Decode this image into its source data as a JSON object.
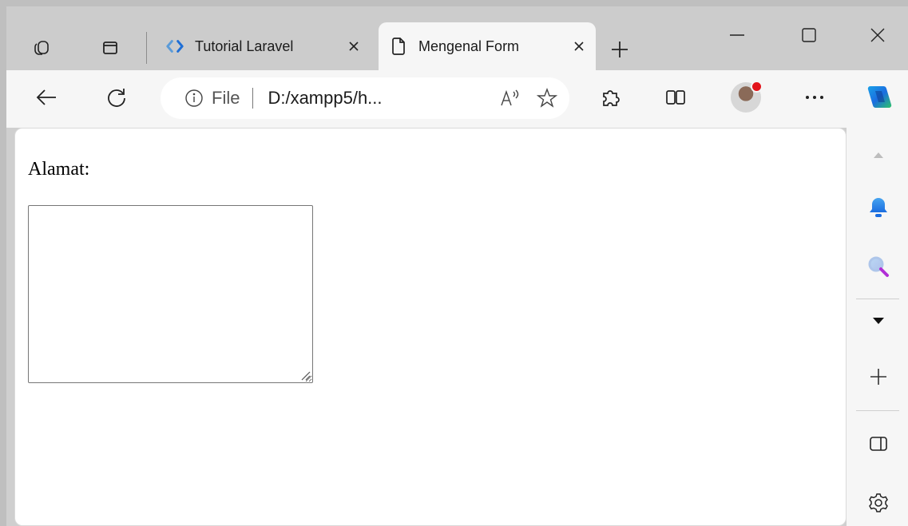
{
  "tabs": [
    {
      "title": "Tutorial Laravel",
      "icon": "code-brackets-icon"
    },
    {
      "title": "Mengenal Form",
      "icon": "document-icon"
    }
  ],
  "address_bar": {
    "scheme": "File",
    "url": "D:/xampp5/h..."
  },
  "page": {
    "label": "Alamat:",
    "textarea_value": ""
  },
  "colors": {
    "accent": "#1f6fd6",
    "copilot_blue": "#1b6de0",
    "notification_red": "#e3141b"
  }
}
